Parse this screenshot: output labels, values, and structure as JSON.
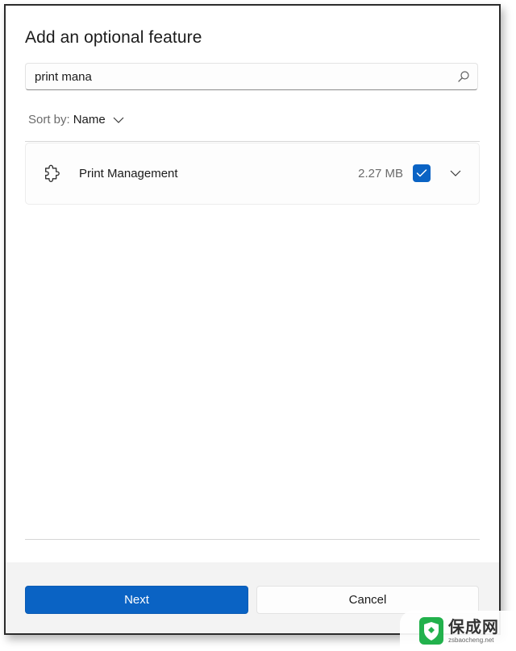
{
  "dialog": {
    "title": "Add an optional feature"
  },
  "search": {
    "value": "print mana",
    "placeholder": "",
    "icon": "search-icon"
  },
  "sort": {
    "label": "Sort by:",
    "value": "Name",
    "icon": "chevron-down-icon"
  },
  "features": [
    {
      "name": "Print Management",
      "size": "2.27 MB",
      "checked": true,
      "icon": "puzzle-piece-icon",
      "expand_icon": "chevron-down-icon"
    }
  ],
  "footer": {
    "next_label": "Next",
    "cancel_label": "Cancel"
  },
  "colors": {
    "accent": "#0a63c4",
    "footer_bg": "#f3f3f3"
  },
  "watermark": {
    "title": "保成网",
    "subtitle": "zsbaocheng.net"
  }
}
